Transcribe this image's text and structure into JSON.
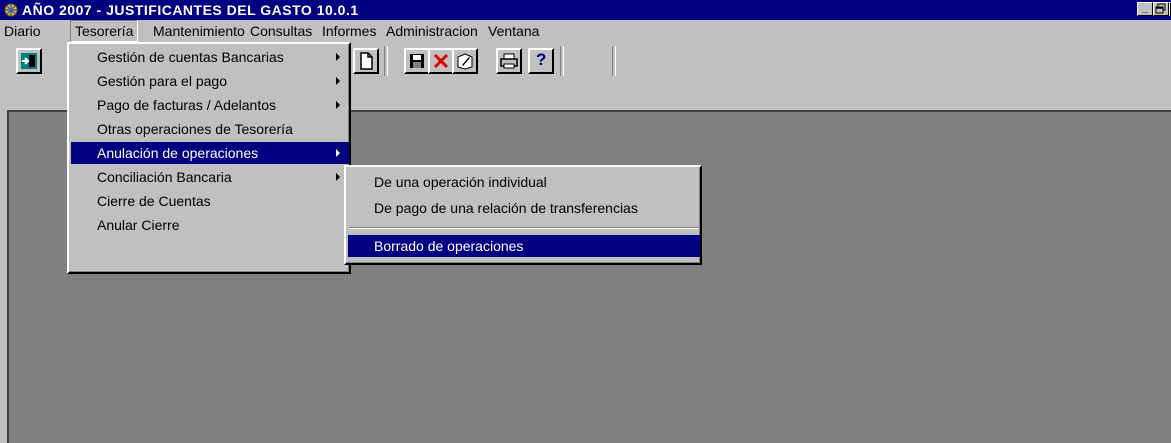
{
  "window": {
    "title": "AÑO 2007 - JUSTIFICANTES DEL GASTO 10.0.1",
    "controls": [
      "minimize-icon",
      "maximize-icon",
      "close-icon"
    ]
  },
  "menubar": {
    "items": [
      {
        "label": "Diario"
      },
      {
        "label": "Tesorería",
        "open": true
      },
      {
        "label": "Mantenimiento"
      },
      {
        "label": "Consultas"
      },
      {
        "label": "Informes"
      },
      {
        "label": "Administracion"
      },
      {
        "label": "Ventana"
      }
    ]
  },
  "toolbar": {
    "buttons": [
      "exit-icon",
      "new-document-icon",
      "save-icon",
      "delete-icon",
      "edit-icon",
      "print-icon",
      "help-icon"
    ],
    "help_label": "?"
  },
  "tesoreria_menu": {
    "items": [
      {
        "label": "Gestión de cuentas Bancarias",
        "submenu": true
      },
      {
        "label": "Gestión para el pago",
        "submenu": true
      },
      {
        "label": "Pago de facturas / Adelantos",
        "submenu": true
      },
      {
        "label": "Otras operaciones de Tesorería",
        "submenu": false
      },
      {
        "label": "Anulación de operaciones",
        "submenu": true,
        "highlighted": true
      },
      {
        "label": "Conciliación Bancaria",
        "submenu": true
      },
      {
        "label": "Cierre de Cuentas",
        "submenu": false
      },
      {
        "label": "Anular Cierre",
        "submenu": false
      }
    ]
  },
  "anulacion_submenu": {
    "items": [
      {
        "label": "De una operación individual"
      },
      {
        "label": "De pago de una relación de transferencias"
      },
      {
        "label": "Borrado de operaciones",
        "highlighted": true
      }
    ]
  },
  "colors": {
    "titlebar": "#000080",
    "highlight": "#000080",
    "face": "#c0c0c0",
    "workspace": "#808080"
  }
}
